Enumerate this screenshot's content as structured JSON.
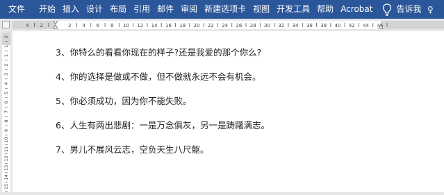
{
  "ribbon": {
    "tabs": [
      "文件",
      "开始",
      "插入",
      "设计",
      "布局",
      "引用",
      "邮件",
      "审阅",
      "新建选项卡",
      "视图",
      "开发工具",
      "帮助",
      "Acrobat"
    ],
    "tell_me": "告诉我",
    "share": "♀",
    "bg_color": "#2b579a"
  },
  "ruler": {
    "horizontal_labels": [
      "4",
      "2",
      "2",
      "4",
      "6",
      "8",
      "10",
      "12",
      "14",
      "16",
      "18",
      "20",
      "22",
      "24",
      "26",
      "28",
      "30",
      "32",
      "34",
      "36",
      "38",
      "40",
      "42",
      "44",
      "46"
    ],
    "vertical_labels": [
      "2",
      "1",
      "1",
      "2",
      "3",
      "4",
      "5",
      "6",
      "7",
      "8",
      "9",
      "10",
      "11",
      "12",
      "13",
      "14",
      "15"
    ]
  },
  "document": {
    "lines": [
      "3、你特么的看看你现在的样子?还是我爱的那个你么?",
      "4、你的选择是做或不做，但不做就永远不会有机会。",
      "5、你必须成功，因为你不能失败。",
      "6、人生有两出悲剧：一是万念俱灰，另一是踌躇满志。",
      "7、男儿不展风云志，空负天生八尺躯。"
    ]
  }
}
